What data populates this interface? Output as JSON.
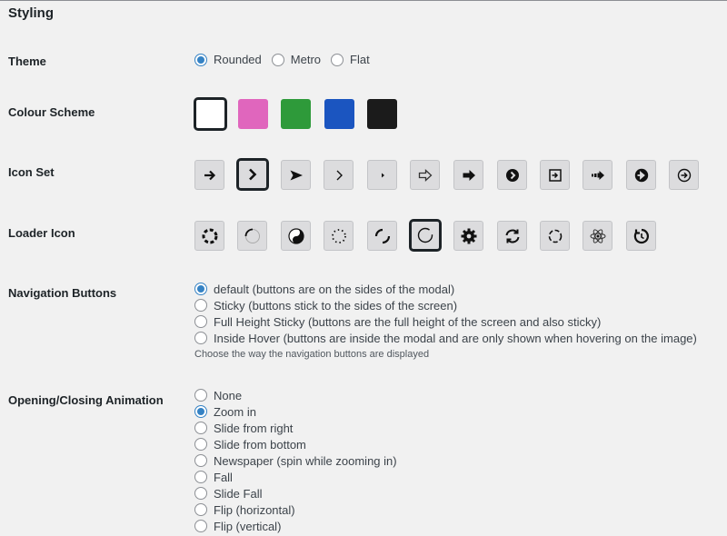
{
  "section_title": "Styling",
  "theme": {
    "label": "Theme",
    "options": [
      "Rounded",
      "Metro",
      "Flat"
    ],
    "selected": "Rounded"
  },
  "colour_scheme": {
    "label": "Colour Scheme",
    "swatches": [
      "#ffffff",
      "#e066bd",
      "#2e9a3a",
      "#1b55c0",
      "#1b1b1b"
    ],
    "selected_index": 0
  },
  "icon_set": {
    "label": "Icon Set",
    "icons": [
      "arrow-right-icon",
      "chevron-bold-right-icon",
      "play-arrow-right-icon",
      "chevron-thin-right-icon",
      "caret-small-right-icon",
      "outline-arrow-right-icon",
      "block-arrow-right-icon",
      "circle-chevron-right-icon",
      "square-arrow-right-icon",
      "dashed-arrow-right-icon",
      "circle-arrow-right-icon",
      "circle-outline-arrow-right-icon"
    ],
    "selected_index": 1
  },
  "loader_icon": {
    "label": "Loader Icon",
    "icons": [
      "dots-ring-loader-icon",
      "arc-loader-icon",
      "yin-yang-loader-icon",
      "dotted-circle-loader-icon",
      "split-arc-loader-icon",
      "thin-ring-loader-icon",
      "gear-loader-icon",
      "refresh-loader-icon",
      "dashed-circle-loader-icon",
      "atom-loader-icon",
      "restart-loader-icon"
    ],
    "selected_index": 5
  },
  "navigation_buttons": {
    "label": "Navigation Buttons",
    "options": [
      "default (buttons are on the sides of the modal)",
      "Sticky (buttons stick to the sides of the screen)",
      "Full Height Sticky (buttons are the full height of the screen and also sticky)",
      "Inside Hover (buttons are inside the modal and are only shown when hovering on the image)"
    ],
    "selected_index": 0,
    "description": "Choose the way the navigation buttons are displayed"
  },
  "animation": {
    "label": "Opening/Closing Animation",
    "options": [
      "None",
      "Zoom in",
      "Slide from right",
      "Slide from bottom",
      "Newspaper (spin while zooming in)",
      "Fall",
      "Slide Fall",
      "Flip (horizontal)",
      "Flip (vertical)"
    ],
    "selected_index": 1
  }
}
